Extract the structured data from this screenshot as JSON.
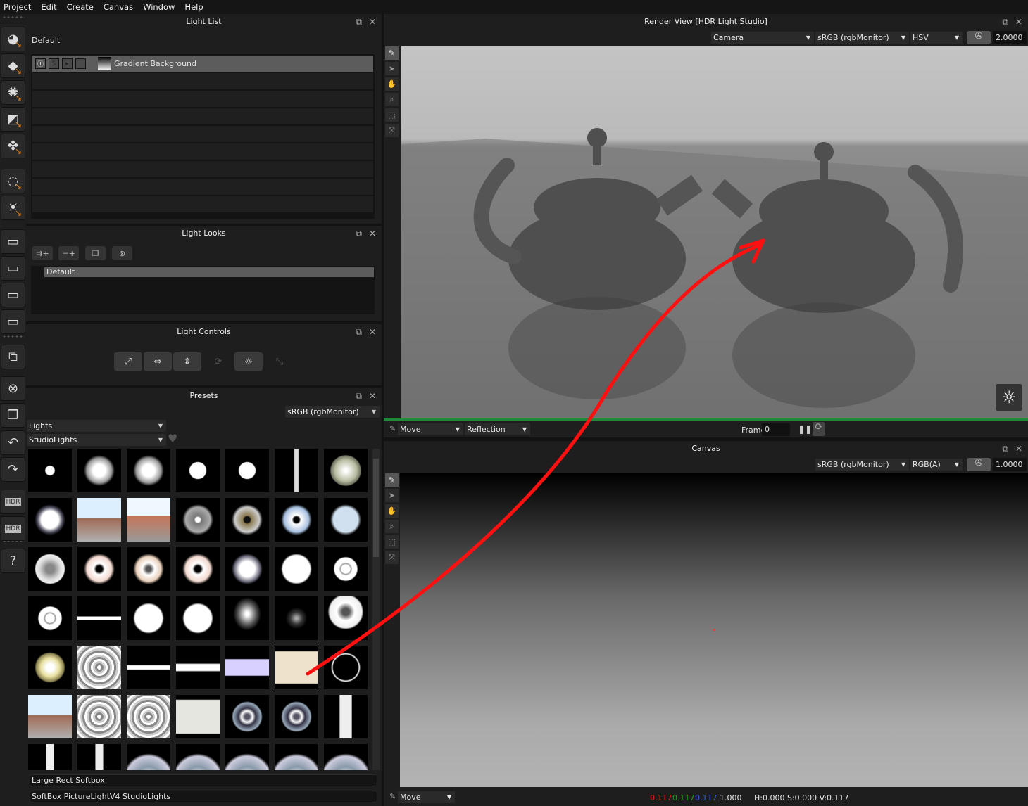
{
  "menu": [
    "Project",
    "Edit",
    "Create",
    "Canvas",
    "Window",
    "Help"
  ],
  "toolbar": {
    "items": [
      {
        "name": "circle-light-tool",
        "glyph": "◕"
      },
      {
        "name": "rect-light-tool",
        "glyph": "◆"
      },
      {
        "name": "soft-light-tool",
        "glyph": "✺"
      },
      {
        "name": "gradient-light-tool",
        "glyph": "◩"
      },
      {
        "name": "pattern-light-tool",
        "glyph": "✤"
      },
      {
        "name": "ring-light-tool",
        "glyph": "◌"
      },
      {
        "name": "light-area-tool",
        "glyph": "☀"
      },
      {
        "name": "canvas-preset-1",
        "glyph": "▭"
      },
      {
        "name": "canvas-preset-2",
        "glyph": "▭"
      },
      {
        "name": "canvas-preset-3",
        "glyph": "▭"
      },
      {
        "name": "canvas-preset-4",
        "glyph": "▭"
      },
      {
        "name": "multi-canvas",
        "glyph": "⧉"
      },
      {
        "name": "delete",
        "glyph": "⊗"
      },
      {
        "name": "duplicate",
        "glyph": "❐"
      },
      {
        "name": "undo",
        "glyph": "↶"
      },
      {
        "name": "redo",
        "glyph": "↷"
      },
      {
        "name": "hdr",
        "glyph": "HDR"
      },
      {
        "name": "hdr-refresh",
        "glyph": "HDR"
      },
      {
        "name": "help",
        "glyph": "?"
      }
    ]
  },
  "light_list": {
    "title": "Light List",
    "look_name": "Default",
    "rows": [
      {
        "label": "Gradient Background",
        "selected": true
      }
    ],
    "row_icons": [
      "Ⓘ",
      "S",
      "▸",
      "🔒"
    ]
  },
  "light_looks": {
    "title": "Light Looks",
    "buttons": [
      "⇉+",
      "⊢+",
      "❐",
      "⊗"
    ],
    "items": [
      "Default"
    ]
  },
  "light_controls": {
    "title": "Light Controls",
    "buttons": [
      {
        "name": "scale",
        "glyph": "⤢",
        "enabled": true
      },
      {
        "name": "width",
        "glyph": "⇔",
        "enabled": true
      },
      {
        "name": "height",
        "glyph": "⇕",
        "enabled": true
      },
      {
        "name": "rotate",
        "glyph": "⟳",
        "enabled": false
      },
      {
        "name": "brightness",
        "glyph": "☼",
        "enabled": true
      },
      {
        "name": "spread",
        "glyph": "⤡",
        "enabled": false
      }
    ]
  },
  "presets": {
    "title": "Presets",
    "color_space": "sRGB (rgbMonitor)",
    "category": "Lights",
    "subcategory": "StudioLights",
    "selected_name": "Large Rect Softbox",
    "selected_path": "SoftBox PictureLightV4 StudioLights",
    "selected_index": 33,
    "thumbs": [
      "spot-small",
      "spot-soft",
      "spot-soft",
      "spot-eyes",
      "spot-eyes",
      "strip-vert",
      "dish-green",
      "square-glow",
      "window",
      "window-street",
      "dish-gray-dot",
      "dish-beige-ring",
      "dish-blue",
      "dish-pale-blue",
      "dish-gray",
      "dish-pink",
      "dish-tan",
      "dish-pink",
      "dish-umbrella",
      "disc-white",
      "ring-white",
      "ring-white",
      "strip-horiz",
      "disc-white",
      "disc-white",
      "half-glow",
      "half-glow-dim",
      "disc-white-dark",
      "dish-yellow",
      "dish-rings",
      "bar-small",
      "bar-large",
      "panel-lavender",
      "softbox-rect",
      "ring-thin",
      "window",
      "dish-rings",
      "dish-rings",
      "panel-white",
      "dish-blue-rings",
      "dish-blue-rings",
      "tube-vert",
      "tube",
      "tube",
      "fan",
      "fan",
      "fan",
      "fan",
      "fan"
    ]
  },
  "render_view": {
    "title": "Render View [HDR Light Studio]",
    "camera": "Camera",
    "color_space": "sRGB (rgbMonitor)",
    "mode": "HSV",
    "exposure": "2.0000",
    "move_mode": "Move",
    "light_mode": "Reflection",
    "frame_label": "Frame",
    "frame_value": "0"
  },
  "canvas": {
    "title": "Canvas",
    "color_space": "sRGB (rgbMonitor)",
    "channel": "RGB(A)",
    "exposure": "1.0000",
    "move_mode": "Move",
    "pixel": {
      "r": "0.117",
      "g": "0.117",
      "b": "0.117",
      "a": "1.000",
      "hsv": "H:0.000 S:0.000 V:0.117"
    }
  },
  "colors": {
    "accent": "#f08a1c",
    "progress_green": "#1f8a36",
    "annotation_arrow": "#ff1010"
  }
}
